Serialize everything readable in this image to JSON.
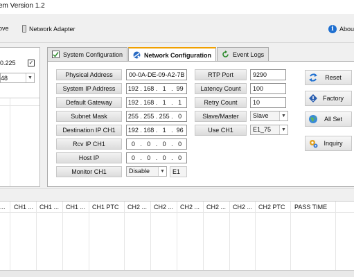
{
  "window": {
    "title": "em Version 1.2"
  },
  "toolbar": {
    "remove_label": "ove",
    "network_adapter_label": "Network Adapter",
    "about_label": "About"
  },
  "left_panel": {
    "ip_text": "0.225",
    "checkbox_mark": "✓",
    "combo_value": "48"
  },
  "tabs": [
    {
      "label": "System Configuration"
    },
    {
      "label": "Network Configuration"
    },
    {
      "label": "Event Logs"
    }
  ],
  "network": {
    "physical_address_label": "Physical Address",
    "physical_address_value": "00-0A-DE-09-A2-7B",
    "system_ip_label": "System IP Address",
    "system_ip": [
      "192",
      "168",
      "1",
      "99"
    ],
    "default_gateway_label": "Default Gateway",
    "default_gateway": [
      "192",
      "168",
      "1",
      "1"
    ],
    "subnet_mask_label": "Subnet Mask",
    "subnet_mask": [
      "255",
      "255",
      "255",
      "0"
    ],
    "destination_ip_label": "Destination IP CH1",
    "destination_ip": [
      "192",
      "168",
      "1",
      "96"
    ],
    "rcv_ip_label": "Rcv IP CH1",
    "rcv_ip": [
      "0",
      "0",
      "0",
      "0"
    ],
    "host_ip_label": "Host IP",
    "host_ip": [
      "0",
      "0",
      "0",
      "0"
    ],
    "monitor_label": "Monitor CH1",
    "monitor_value": "Disable",
    "monitor_suffix": "E1",
    "rtp_port_label": "RTP Port",
    "rtp_port_value": "9290",
    "latency_label": "Latency Count",
    "latency_value": "100",
    "retry_label": "Retry Count",
    "retry_value": "10",
    "slave_master_label": "Slave/Master",
    "slave_master_value": "Slave",
    "use_ch1_label": "Use CH1",
    "use_ch1_value": "E1_75"
  },
  "actions": {
    "reset_label": "Reset",
    "factory_label": "Factory",
    "allset_label": "All Set",
    "inquiry_label": "Inquiry"
  },
  "grid": {
    "columns": [
      "...",
      "CH1 ...",
      "CH1 ...",
      "CH1 ...",
      "CH1 PTC",
      "CH2 ...",
      "CH2 ...",
      "CH2 ...",
      "CH2 ...",
      "CH2 ...",
      "CH2 PTC",
      "PASS TIME"
    ]
  },
  "colors": {
    "accent": "#f0a000",
    "info_blue": "#1e6fd0"
  }
}
